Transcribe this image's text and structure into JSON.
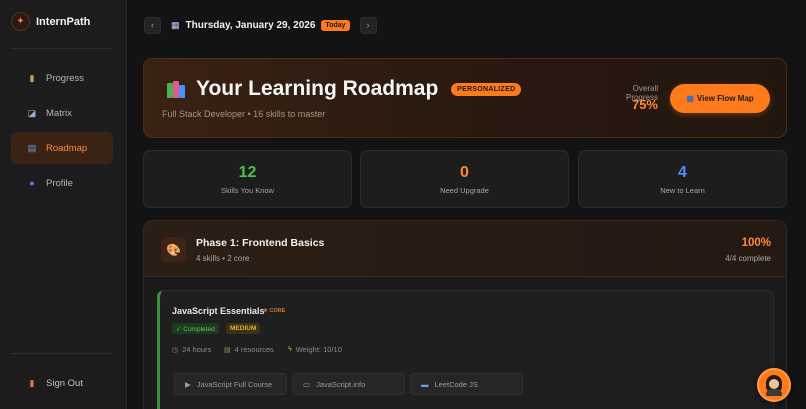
{
  "app": {
    "name": "InternPath"
  },
  "sidebar": {
    "items": [
      {
        "label": "Progress",
        "icon": "bar-chart-icon",
        "active": false
      },
      {
        "label": "Matrix",
        "icon": "trend-chart-icon",
        "active": false
      },
      {
        "label": "Roadmap",
        "icon": "book-icon",
        "active": true
      },
      {
        "label": "Profile",
        "icon": "person-icon",
        "active": false
      }
    ],
    "signout_label": "Sign Out"
  },
  "datebar": {
    "date": "Thursday, January 29, 2026",
    "today_label": "Today",
    "prev_symbol": "‹",
    "next_symbol": "›"
  },
  "hero": {
    "title": "Your Learning Roadmap",
    "badge": "PERSONALIZED",
    "subtitle": "Full Stack Developer • 16 skills to master",
    "overall_label": "Overall Progress",
    "overall_value": "75%",
    "flow_button": "View Flow Map"
  },
  "stats": [
    {
      "value": "12",
      "label": "Skills You Know",
      "color": "#4fbf4f"
    },
    {
      "value": "0",
      "label": "Need Upgrade",
      "color": "#ff8a2a"
    },
    {
      "value": "4",
      "label": "New to Learn",
      "color": "#4a8fff"
    }
  ],
  "phase": {
    "title": "Phase 1: Frontend Basics",
    "subtitle": "4 skills • 2 core",
    "percent": "100%",
    "complete": "4/4 complete",
    "skill": {
      "name": "JavaScript Essentials",
      "core_tag": "★ CORE",
      "status_tag": "✓ Completed",
      "level_tag": "MEDIUM",
      "hours": "24 hours",
      "resources": "4 resources",
      "weight": "Weight: 10/10",
      "resource_buttons": [
        {
          "label": "JavaScript Full Course",
          "icon": "video-icon"
        },
        {
          "label": "JavaScript.info",
          "icon": "book-icon"
        },
        {
          "label": "LeetCode JS",
          "icon": "laptop-icon"
        }
      ]
    }
  },
  "colors": {
    "accent": "#ff7a1a",
    "success": "#4fbf4f",
    "info": "#4a8fff"
  }
}
